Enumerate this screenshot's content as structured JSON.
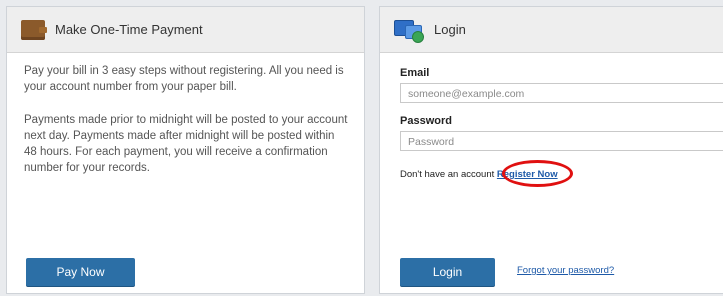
{
  "payment": {
    "title": "Make One-Time Payment",
    "paragraph1": "Pay your bill in 3 easy steps without registering. All you need is your account number from your paper bill.",
    "paragraph2": "Payments made prior to midnight will be posted to your account next day. Payments made after midnight will be posted within 48 hours. For each payment, you will receive a confirmation number for your records.",
    "pay_button": "Pay Now"
  },
  "login": {
    "title": "Login",
    "email_label": "Email",
    "email_placeholder": "someone@example.com",
    "password_label": "Password",
    "password_placeholder": "Password",
    "register_prompt": "Don't have an account",
    "register_link": "Register Now",
    "login_button": "Login",
    "forgot_link": "Forgot your password?"
  },
  "colors": {
    "button": "#2c6fa6",
    "link": "#1e5aa8",
    "highlight": "#e01010"
  }
}
